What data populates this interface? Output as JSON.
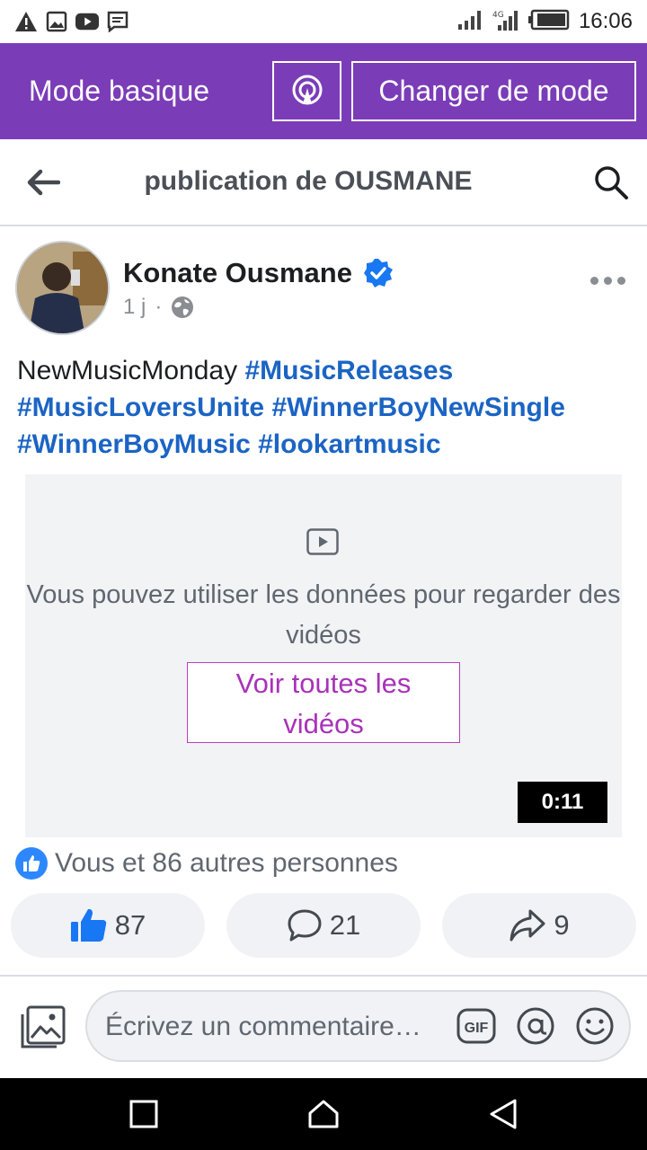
{
  "status_bar": {
    "time": "16:06",
    "left_icons": [
      "warning-icon",
      "image-icon",
      "youtube-icon",
      "message-icon"
    ],
    "right_icons": [
      "signal-icon",
      "signal-2-icon",
      "battery-icon"
    ]
  },
  "mode_bar": {
    "label": "Mode basique",
    "change_button": "Changer de mode",
    "icon": "broadcast-icon",
    "background": "#7b3cb8"
  },
  "header": {
    "title": "publication de OUSMANE"
  },
  "post": {
    "author": "Konate Ousmane",
    "verified": true,
    "time": "1 j",
    "separator": "·",
    "text_plain": "NewMusicMonday",
    "hashtags": [
      "#MusicReleases",
      "#MusicLoversUnite",
      "#WinnerBoyNewSingle",
      "#WinnerBoyMusic",
      "#lookartmusic"
    ],
    "video": {
      "message": "Vous pouvez utiliser les données pour regarder des vidéos",
      "button": "Voir toutes les vidéos",
      "duration": "0:11"
    },
    "reactions_text": "Vous et 86 autres personnes",
    "like_count": "87",
    "comment_count": "21",
    "share_count": "9"
  },
  "composer": {
    "placeholder": "Écrivez un commentaire…",
    "gif_label": "GIF"
  },
  "colors": {
    "hashtag": "#1b64c4",
    "like_blue": "#2d88ff",
    "video_button": "#a832b8"
  }
}
